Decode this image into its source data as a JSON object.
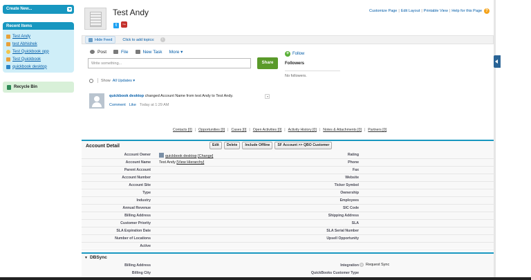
{
  "sidebar": {
    "create_new": "Create New...",
    "recent_title": "Recent Items",
    "recent_items": [
      {
        "label": "Test Andy",
        "icon": "account-icon",
        "color": "#e8a13a"
      },
      {
        "label": "test Abhishek",
        "icon": "account-icon",
        "color": "#e8a13a"
      },
      {
        "label": "Test Quickbook opp",
        "icon": "opportunity-icon",
        "color": "#f1c64a"
      },
      {
        "label": "Test Quickbook",
        "icon": "account-icon",
        "color": "#e8a13a"
      },
      {
        "label": "quickbook desktop",
        "icon": "user-icon",
        "color": "#2c86c8"
      }
    ],
    "recycle_bin": "Recycle Bin"
  },
  "header": {
    "title": "Test Andy",
    "links": [
      "Customize Page",
      "Edit Layout",
      "Printable View",
      "Help for this Page"
    ],
    "twitter": "t",
    "youtube": "You Tube"
  },
  "feed_bar": {
    "hide_feed": "Hide Feed",
    "add_topics": "Click to add topics:"
  },
  "publisher": {
    "tabs": [
      {
        "label": "Post",
        "icon": "post-icon",
        "color": "#7a7a7a"
      },
      {
        "label": "File",
        "icon": "file-icon",
        "color": "#7a7a7a"
      },
      {
        "label": "New Task",
        "icon": "task-icon",
        "color": "#7a7a7a"
      }
    ],
    "more": "More",
    "placeholder": "Write something...",
    "share": "Share"
  },
  "followers": {
    "follow": "Follow",
    "title": "Followers",
    "empty": "No followers."
  },
  "filter": {
    "show": "Show",
    "option": "All Updates"
  },
  "feed_item": {
    "author": "quickbook desktop",
    "text": "changed Account Name from test Andy to Test Andy.",
    "comment": "Comment",
    "like": "Like",
    "time": "Today at 1:29 AM"
  },
  "related": [
    "Contacts [0]",
    "Opportunities [0]",
    "Cases [0]",
    "Open Activities [0]",
    "Activity History [0]",
    "Notes & Attachments [0]",
    "Partners [0]"
  ],
  "account_detail": {
    "title": "Account Detail",
    "buttons": [
      "Edit",
      "Delete",
      "Include Offline",
      "SF Account >> QBO Customer"
    ],
    "owner_value": "quickbook desktop",
    "owner_change": "[Change]",
    "name_value": "Test Andy",
    "name_hierarchy": "[View Hierarchy]",
    "left_labels": [
      "Account Owner",
      "Account Name",
      "Parent Account",
      "Account Number",
      "Account Site",
      "Type",
      "Industry",
      "Annual Revenue",
      "Billing Address",
      "Customer Priority",
      "SLA Expiration Date",
      "Number of Locations",
      "Active"
    ],
    "right_labels": [
      "Rating",
      "Phone",
      "Fax",
      "Website",
      "Ticker Symbol",
      "Ownership",
      "Employees",
      "SIC Code",
      "Shipping Address",
      "SLA",
      "SLA Serial Number",
      "Upsell Opportunity",
      ""
    ]
  },
  "dbsync": {
    "title": "DBSync",
    "billing_address": "Billing Address",
    "billing_city": "Billing City",
    "integration": "Integration",
    "request_sync": "Request Sync",
    "customer_type": "QuickBooks Customer Type"
  }
}
